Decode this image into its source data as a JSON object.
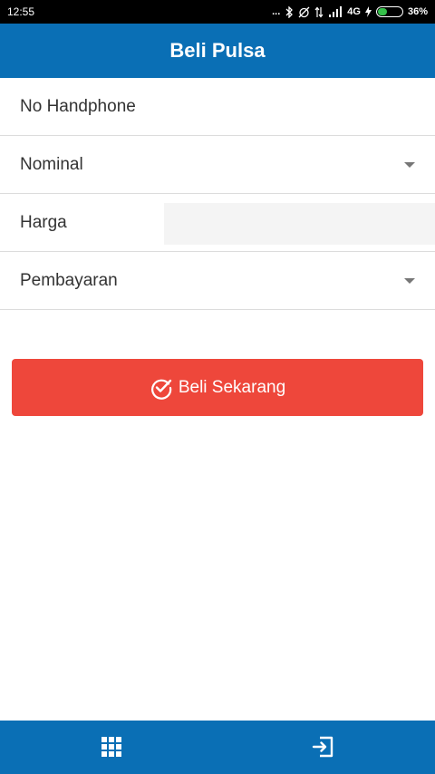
{
  "status_bar": {
    "time": "12:55",
    "dots": "...",
    "network": "4G",
    "battery_percent": "36%",
    "battery_level": 0.36
  },
  "header": {
    "title": "Beli Pulsa"
  },
  "form": {
    "phone_label": "No Handphone",
    "nominal_label": "Nominal",
    "price_label": "Harga",
    "payment_label": "Pembayaran"
  },
  "actions": {
    "buy_label": "Beli Sekarang"
  },
  "colors": {
    "primary": "#0a6fb5",
    "accent": "#ee473b",
    "battery": "#35c14a"
  },
  "bottom_nav": {
    "left_icon": "grid-icon",
    "right_icon": "exit-icon"
  }
}
